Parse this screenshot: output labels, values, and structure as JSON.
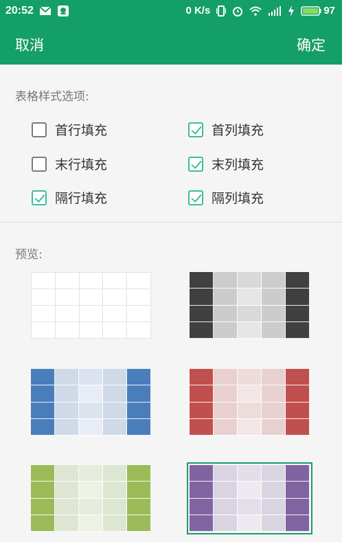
{
  "status": {
    "time": "20:52",
    "speed": "0 K/s",
    "battery": "97"
  },
  "header": {
    "cancel": "取消",
    "confirm": "确定"
  },
  "options": {
    "title": "表格样式选项:",
    "items": [
      {
        "label": "首行填充",
        "checked": false
      },
      {
        "label": "首列填充",
        "checked": true
      },
      {
        "label": "末行填充",
        "checked": false
      },
      {
        "label": "末列填充",
        "checked": true
      },
      {
        "label": "隔行填充",
        "checked": true
      },
      {
        "label": "隔列填充",
        "checked": true
      }
    ]
  },
  "preview": {
    "title": "预览:",
    "styles": [
      {
        "name": "white",
        "edge": "#ffffff",
        "band": "#ffffff",
        "light": "#ffffff",
        "plain": true
      },
      {
        "name": "black",
        "edge": "#404040",
        "band": "#cccccc",
        "light": "#e6e6e6",
        "plain": false
      },
      {
        "name": "blue",
        "edge": "#4a7ebb",
        "band": "#cfd9e8",
        "light": "#e8edf5",
        "plain": false
      },
      {
        "name": "red",
        "edge": "#c0504d",
        "band": "#e9d0d0",
        "light": "#f3e6e6",
        "plain": false
      },
      {
        "name": "green",
        "edge": "#9bbb59",
        "band": "#dde6d1",
        "light": "#edf2e7",
        "plain": false
      },
      {
        "name": "purple",
        "edge": "#8064a2",
        "band": "#d9d4e1",
        "light": "#ede9f1",
        "plain": false,
        "selected": true
      }
    ]
  }
}
